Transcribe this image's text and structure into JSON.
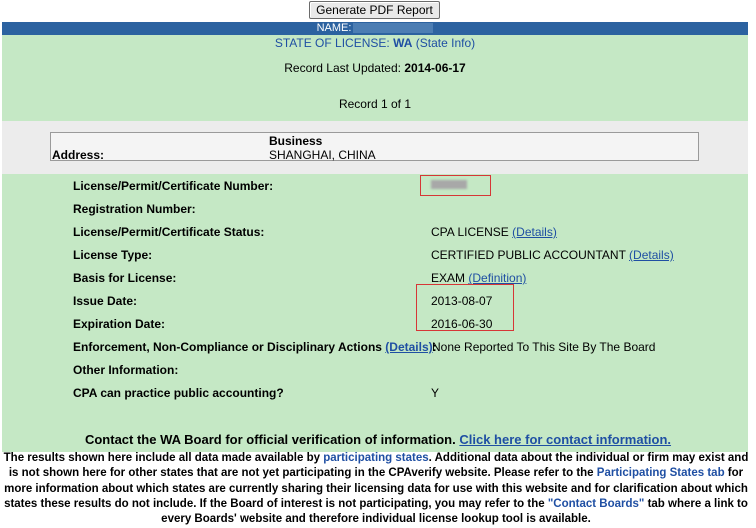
{
  "toolbar": {
    "generate_pdf_label": "Generate PDF Report"
  },
  "header": {
    "name_label": "NAME:"
  },
  "state": {
    "label": "STATE OF LICENSE:",
    "value": "WA",
    "info_link": "(State Info)"
  },
  "record": {
    "updated_label": "Record Last Updated:",
    "updated_value": "2014-06-17",
    "counter": "Record 1 of 1"
  },
  "address": {
    "business_label": "Business",
    "address_label": "Address:",
    "address_value": "SHANGHAI, CHINA"
  },
  "details": {
    "license_number_label": "License/Permit/Certificate Number:",
    "registration_number_label": "Registration Number:",
    "status_label": "License/Permit/Certificate Status:",
    "status_value": "CPA LICENSE",
    "status_link": "(Details)",
    "type_label": "License Type:",
    "type_value": "CERTIFIED PUBLIC ACCOUNTANT",
    "type_link": "(Details)",
    "basis_label": "Basis for License:",
    "basis_value": "EXAM",
    "basis_link": "(Definition)",
    "issue_label": "Issue Date:",
    "issue_value": "2013-08-07",
    "expiration_label": "Expiration Date:",
    "expiration_value": "2016-06-30",
    "enforcement_label": "Enforcement, Non-Compliance or Disciplinary Actions",
    "enforcement_link": "(Details)",
    "enforcement_colon": ":",
    "enforcement_value": "None Reported To This Site By The Board",
    "other_label": "Other Information:",
    "practice_label": "CPA can practice public accounting?",
    "practice_value": "Y"
  },
  "contact": {
    "text": "Contact the WA Board for official verification of information.",
    "link": "Click here for contact information."
  },
  "disclaimer": {
    "part1": "The results shown here include all data made available by ",
    "link1": "participating states",
    "part2": ". Additional data about the individual or firm may exist and is not shown here for other states that are not yet participating in the CPAverify website. Please refer to the ",
    "link2": "Participating States tab",
    "part3": " for more information about which states are currently sharing their licensing data for use with this website and for clarification about which states these results do not include. If the Board of interest is not participating, you may refer to the ",
    "link3": "\"Contact Boards\"",
    "part4": " tab where a link to every Boards' website and therefore individual license lookup tool is available."
  },
  "colors": {
    "name_bar": "#2c62a0",
    "green_panel": "#c5e8c5",
    "link": "#1f4fa3",
    "highlight_box": "#d63636"
  }
}
